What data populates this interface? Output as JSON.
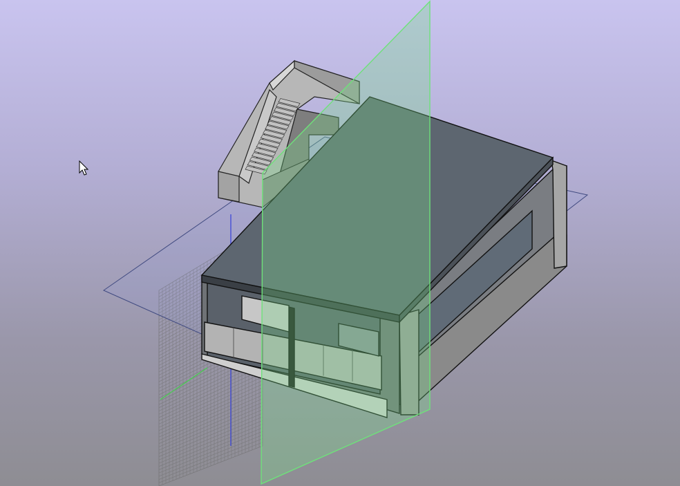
{
  "viewer": {
    "background_top": "#c9c4ef",
    "background_bottom": "#8e8d93",
    "model_color": "#9e9e9e",
    "roof_color": "#5d6670",
    "section_plane_color": "#6ee27a",
    "working_plane_color": "#8f9bd6",
    "grid_color": "#6f6f6f",
    "axis_colors": {
      "x": "#d24b4b",
      "y": "#45d14e",
      "z": "#3d47d8"
    }
  },
  "cursor": {
    "icon": "arrow-pointer-icon"
  }
}
